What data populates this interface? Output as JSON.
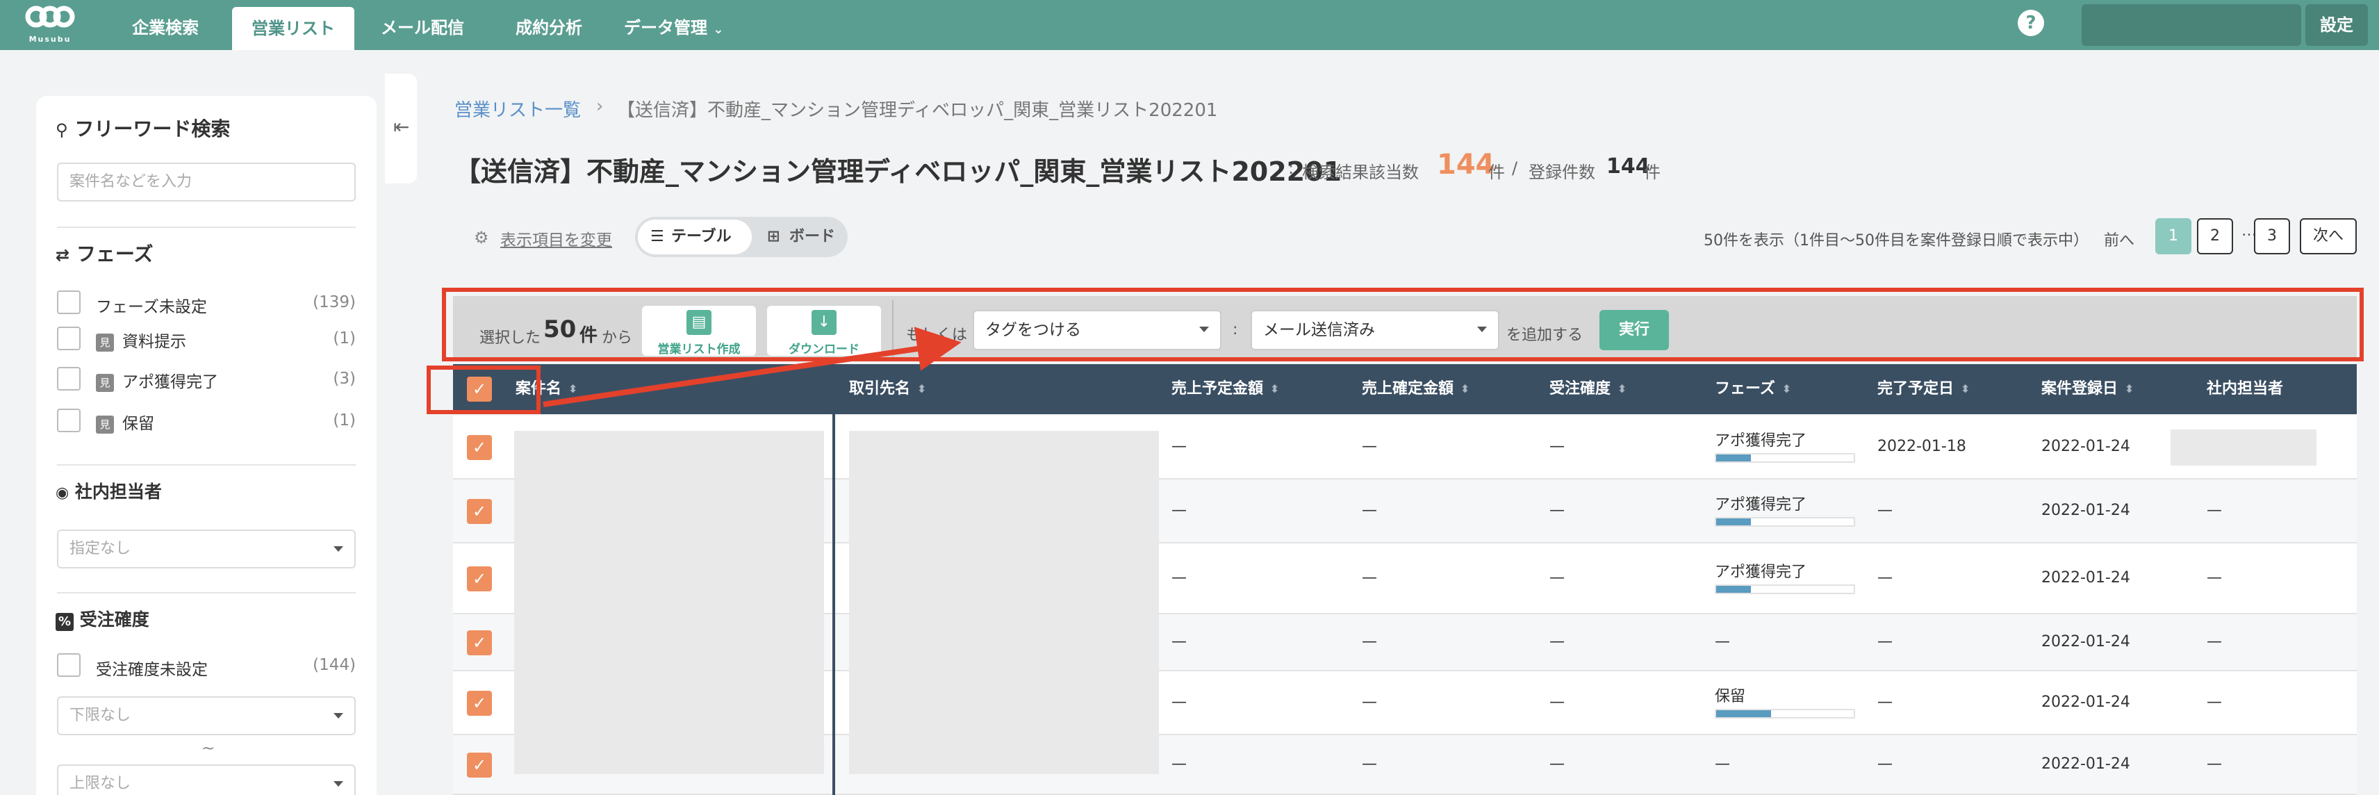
{
  "nav": {
    "logo_text": "Musubu",
    "items": [
      "企業検索",
      "営業リスト",
      "メール配信",
      "成約分析",
      "データ管理"
    ],
    "active": "営業リスト",
    "help": "?",
    "settings": "設定"
  },
  "sidebar": {
    "search_title": "フリーワード検索",
    "search_placeholder": "案件名などを入力",
    "phase_title": "フェーズ",
    "phases": [
      {
        "label": "フェーズ未設定",
        "count": "(139)",
        "badge": ""
      },
      {
        "label": "資料提示",
        "count": "(1)",
        "badge": "見"
      },
      {
        "label": "アポ獲得完了",
        "count": "(3)",
        "badge": "見"
      },
      {
        "label": "保留",
        "count": "(1)",
        "badge": "見"
      }
    ],
    "owner_title": "社内担当者",
    "owner_placeholder": "指定なし",
    "prob_title": "受注確度",
    "prob_unset_label": "受注確度未設定",
    "prob_unset_count": "(144)",
    "lower_placeholder": "下限なし",
    "tilde": "~",
    "upper_placeholder": "上限なし"
  },
  "main": {
    "breadcrumb_root": "営業リスト一覧",
    "breadcrumb_sep": "›",
    "breadcrumb_current": "【送信済】不動産_マンション管理ディベロッパ_関東_営業リスト202201",
    "title": "【送信済】不動産_マンション管理ディベロッパ_関東_営業リスト202201",
    "colon": ":",
    "hits_label": "検索結果該当数",
    "hits_value": "144",
    "hits_unit": "件",
    "slash": "/",
    "registered_label": "登録件数",
    "registered_value": "144",
    "registered_unit": "件",
    "change_columns": "表示項目を変更",
    "view_table": "テーブル",
    "view_board": "ボード",
    "showing": "50件を表示（1件目〜50件目を案件登録日順で表示中）",
    "prev": "前へ",
    "pages": [
      "1",
      "2",
      "3"
    ],
    "dots": "…",
    "next": "次へ"
  },
  "action_bar": {
    "selected_prefix": "選択した",
    "selected_count": "50",
    "selected_unit": "件",
    "selected_suffix": "から",
    "create_list": "営業リスト作成",
    "download": "ダウンロード",
    "or": "もしくは",
    "tag_action": "タグをつける",
    "colon": ":",
    "tag_value": "メール送信済み",
    "add_suffix": "を追加する",
    "run": "実行"
  },
  "table": {
    "headers": [
      "案件名",
      "取引先名",
      "売上予定金額",
      "売上確定金額",
      "受注確度",
      "フェーズ",
      "完了予定日",
      "案件登録日",
      "社内担当者"
    ],
    "rows": [
      {
        "sales": "—",
        "fixed": "—",
        "prob": "—",
        "phase": "アポ獲得完了",
        "phase_level": 0.25,
        "due": "2022-01-18",
        "registered": "2022-01-24",
        "owner": ""
      },
      {
        "sales": "—",
        "fixed": "—",
        "prob": "—",
        "phase": "アポ獲得完了",
        "phase_level": 0.25,
        "due": "—",
        "registered": "2022-01-24",
        "owner": "—"
      },
      {
        "sales": "—",
        "fixed": "—",
        "prob": "—",
        "phase": "アポ獲得完了",
        "phase_level": 0.25,
        "due": "—",
        "registered": "2022-01-24",
        "owner": "—"
      },
      {
        "sales": "—",
        "fixed": "—",
        "prob": "—",
        "phase": "—",
        "phase_level": 0,
        "due": "—",
        "registered": "2022-01-24",
        "owner": "—"
      },
      {
        "sales": "—",
        "fixed": "—",
        "prob": "—",
        "phase": "保留",
        "phase_level": 0.4,
        "due": "—",
        "registered": "2022-01-24",
        "owner": "—"
      },
      {
        "sales": "—",
        "fixed": "—",
        "prob": "—",
        "phase": "—",
        "phase_level": 0,
        "due": "—",
        "registered": "2022-01-24",
        "owner": "—"
      }
    ]
  },
  "colors": {
    "brand": "#5a9e91",
    "accent": "#ef8f5f",
    "header": "#3b4f63",
    "highlight": "#e4412b"
  }
}
